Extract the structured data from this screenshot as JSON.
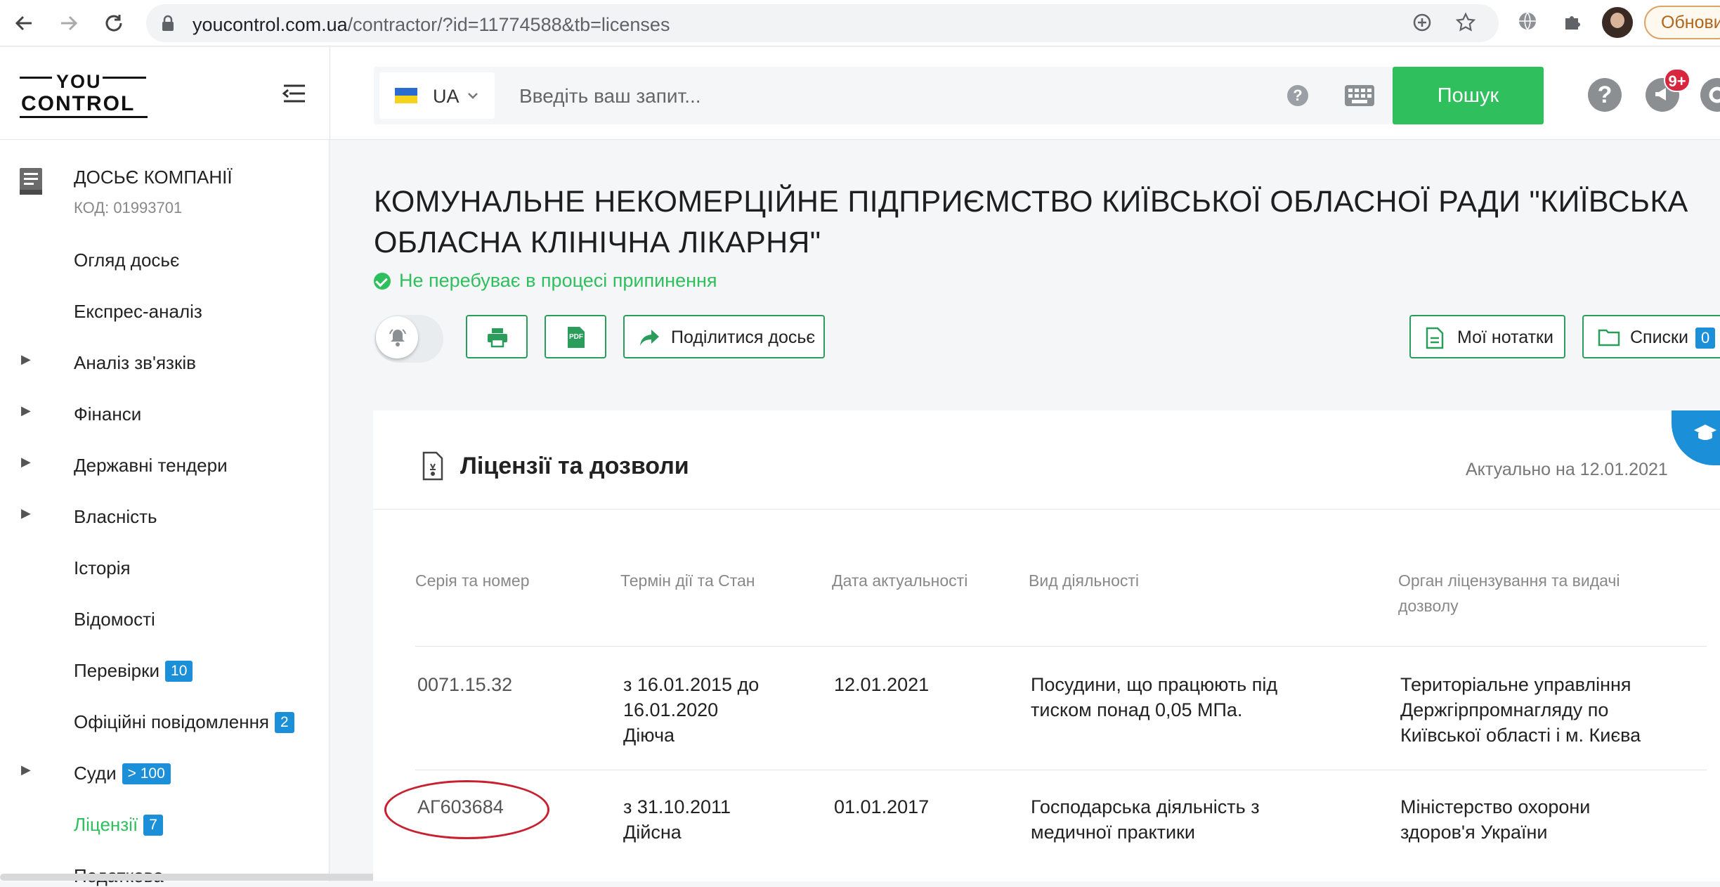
{
  "browser": {
    "url_host": "youcontrol.com.ua",
    "url_path": "/contractor/?id=11774588&tb=licenses",
    "update_label": "Обнови"
  },
  "header": {
    "logo_top": "YOU",
    "logo_bottom": "CONTROL",
    "lang": "UA",
    "search_placeholder": "Введіть ваш запит...",
    "search_button": "Пошук",
    "notify_badge": "9+",
    "help_label": "?"
  },
  "sidebar": {
    "title": "ДОСЬЄ КОМПАНІЇ",
    "code": "КОД: 01993701",
    "items": [
      {
        "label": "Огляд досьє"
      },
      {
        "label": "Експрес-аналіз"
      },
      {
        "label": "Аналіз зв'язків"
      },
      {
        "label": "Фінанси"
      },
      {
        "label": "Державні тендери"
      },
      {
        "label": "Власність"
      },
      {
        "label": "Історія"
      },
      {
        "label": "Відомості"
      },
      {
        "label": "Перевірки",
        "count": "10"
      },
      {
        "label": "Офіційні повідомлення",
        "count": "2"
      },
      {
        "label": "Суди",
        "count": "> 100"
      },
      {
        "label": "Ліцензії",
        "count": "7"
      },
      {
        "label": "Податкова"
      }
    ]
  },
  "company": {
    "title": "КОМУНАЛЬНЕ НЕКОМЕРЦІЙНЕ ПІДПРИЄМСТВО КИЇВСЬКОЇ ОБЛАСНОЇ РАДИ \"КИЇВСЬКА ОБЛАСНА КЛІНІЧНА ЛІКАРНЯ\"",
    "status": "Не перебуває в процесі припинення"
  },
  "toolbar": {
    "share_label": "Поділитися досьє",
    "notes_label": "Мої нотатки",
    "lists_label": "Списки",
    "lists_count": "0",
    "pdf_label": "PDF"
  },
  "licenses": {
    "title": "Ліцензії та дозволи",
    "actual": "Актуально на 12.01.2021",
    "columns": [
      "Серія та номер",
      "Термін дії та Стан",
      "Дата актуальності",
      "Вид діяльності",
      "Орган ліцензування та видачі дозволу"
    ],
    "rows": [
      {
        "number": "0071.15.32",
        "term_1": "з 16.01.2015 до",
        "term_2": "16.01.2020",
        "state": "Діюча",
        "date": "12.01.2021",
        "activity_1": "Посудини, що працюють під",
        "activity_2": "тиском понад 0,05 МПа.",
        "authority_1": "Територіальне управління",
        "authority_2": "Держгірпромнагляду по",
        "authority_3": "Київської області і м. Києва"
      },
      {
        "number": "АГ603684",
        "term_1": "з 31.10.2011",
        "state": "Дійсна",
        "date": "01.01.2017",
        "activity_1": "Господарська діяльність з",
        "activity_2": "медичної практики",
        "authority_1": "Міністерство охорони",
        "authority_2": "здоров'я України"
      }
    ]
  }
}
